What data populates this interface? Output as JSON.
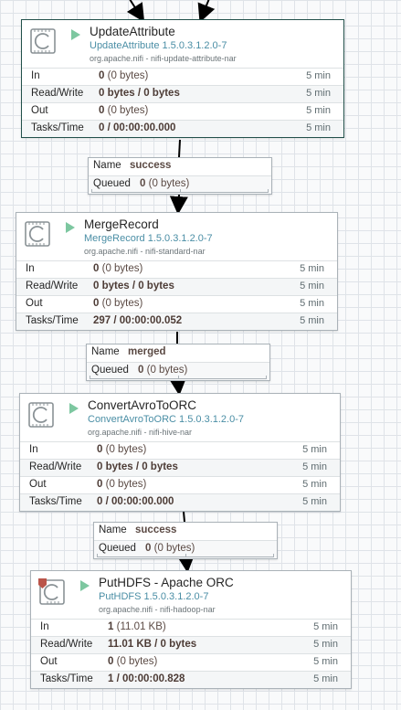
{
  "colors": {
    "canvas": "#f9fafb",
    "run_indicator": "#7dc7a0",
    "type_text": "#4a8ea5",
    "selected_border": "#22504a"
  },
  "processors": [
    {
      "name": "UpdateAttribute",
      "type": "UpdateAttribute 1.5.0.3.1.2.0-7",
      "bundle": "org.apache.nifi - nifi-update-attribute-nar",
      "icon": "processor-icon",
      "status_icon": "play-icon",
      "stats": [
        {
          "label": "In",
          "value": "0",
          "detail": "(0 bytes)",
          "period": "5 min"
        },
        {
          "label": "Read/Write",
          "value": "0 bytes / 0 bytes",
          "detail": "",
          "period": "5 min"
        },
        {
          "label": "Out",
          "value": "0",
          "detail": "(0 bytes)",
          "period": "5 min"
        },
        {
          "label": "Tasks/Time",
          "value": "0 / 00:00:00.000",
          "detail": "",
          "period": "5 min"
        }
      ]
    },
    {
      "name": "MergeRecord",
      "type": "MergeRecord 1.5.0.3.1.2.0-7",
      "bundle": "org.apache.nifi - nifi-standard-nar",
      "icon": "processor-icon",
      "status_icon": "play-icon",
      "stats": [
        {
          "label": "In",
          "value": "0",
          "detail": "(0 bytes)",
          "period": "5 min"
        },
        {
          "label": "Read/Write",
          "value": "0 bytes / 0 bytes",
          "detail": "",
          "period": "5 min"
        },
        {
          "label": "Out",
          "value": "0",
          "detail": "(0 bytes)",
          "period": "5 min"
        },
        {
          "label": "Tasks/Time",
          "value": "297 / 00:00:00.052",
          "detail": "",
          "period": "5 min"
        }
      ]
    },
    {
      "name": "ConvertAvroToORC",
      "type": "ConvertAvroToORC 1.5.0.3.1.2.0-7",
      "bundle": "org.apache.nifi - nifi-hive-nar",
      "icon": "processor-icon",
      "status_icon": "play-icon",
      "stats": [
        {
          "label": "In",
          "value": "0",
          "detail": "(0 bytes)",
          "period": "5 min"
        },
        {
          "label": "Read/Write",
          "value": "0 bytes / 0 bytes",
          "detail": "",
          "period": "5 min"
        },
        {
          "label": "Out",
          "value": "0",
          "detail": "(0 bytes)",
          "period": "5 min"
        },
        {
          "label": "Tasks/Time",
          "value": "0 / 00:00:00.000",
          "detail": "",
          "period": "5 min"
        }
      ]
    },
    {
      "name": "PutHDFS - Apache ORC",
      "type": "PutHDFS 1.5.0.3.1.2.0-7",
      "bundle": "org.apache.nifi - nifi-hadoop-nar",
      "icon": "restricted-processor-icon",
      "status_icon": "play-icon",
      "stats": [
        {
          "label": "In",
          "value": "1",
          "detail": "(11.01 KB)",
          "period": "5 min"
        },
        {
          "label": "Read/Write",
          "value": "11.01 KB / 0 bytes",
          "detail": "",
          "period": "5 min"
        },
        {
          "label": "Out",
          "value": "0",
          "detail": "(0 bytes)",
          "period": "5 min"
        },
        {
          "label": "Tasks/Time",
          "value": "1 / 00:00:00.828",
          "detail": "",
          "period": "5 min"
        }
      ]
    }
  ],
  "connections": [
    {
      "name_label": "Name",
      "name": "success",
      "queued_label": "Queued",
      "queued_count": "0",
      "queued_size": "(0 bytes)"
    },
    {
      "name_label": "Name",
      "name": "merged",
      "queued_label": "Queued",
      "queued_count": "0",
      "queued_size": "(0 bytes)"
    },
    {
      "name_label": "Name",
      "name": "success",
      "queued_label": "Queued",
      "queued_count": "0",
      "queued_size": "(0 bytes)"
    }
  ]
}
